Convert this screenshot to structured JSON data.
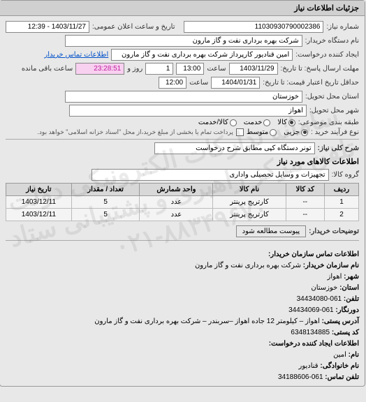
{
  "header": "جزئیات اطلاعات نیاز",
  "need_number_label": "شماره نیاز:",
  "need_number": "11030930790002386",
  "announce_label": "تاریخ و ساعت اعلان عمومی:",
  "announce_value": "1403/11/27 - 12:39",
  "buyer_org_label": "نام دستگاه خریدار:",
  "buyer_org": "شرکت بهره برداری نفت و گاز مارون",
  "requester_label": "ایجاد کننده درخواست:",
  "requester": "امین قنادیور کارپرداز شرکت بهره برداری نفت و گاز مارون",
  "contact_link": "اطلاعات تماس خریدار",
  "deadline_send_label": "مهلت ارسال پاسخ: تا تاریخ:",
  "deadline_send_date": "1403/11/29",
  "time_label": "ساعت",
  "deadline_send_time": "13:00",
  "days_remain": "1",
  "days_label": "روز و",
  "remaining_time": "23:28:51",
  "remaining_label": "ساعت باقی مانده",
  "validity_label": "حداقل تاریخ اعتبار قیمت: تا تاریخ:",
  "validity_date": "1404/01/31",
  "validity_time": "12:00",
  "province_label": "استان محل تحویل:",
  "province": "خوزستان",
  "city_label": "شهر محل تحویل:",
  "city": "اهواز",
  "subject_class_label": "طبقه بندی موضوعی:",
  "radio_goods": "کالا",
  "radio_service": "خدمت",
  "radio_goods_service": "کالا/خدمت",
  "purchase_type_label": "نوع فرآیند خرید :",
  "radio_minor": "جزیی",
  "radio_medium": "متوسط",
  "purchase_note": "پرداخت تمام یا بخشی از مبلغ خرید،از محل \"اسناد خزانه اسلامی\" خواهد بود.",
  "need_desc_label": "شرح کلی نیاز:",
  "need_desc": "تونر دستگاه کپی مطابق شرح درخواست",
  "items_title": "اطلاعات کالاهای مورد نیاز",
  "group_label": "گروه کالا:",
  "group_value": "تجهیزات و وسایل تحصیلی واداری",
  "table": {
    "headers": [
      "ردیف",
      "کد کالا",
      "نام کالا",
      "واحد شمارش",
      "تعداد / مقدار",
      "تاریخ نیاز"
    ],
    "rows": [
      [
        "1",
        "--",
        "کارتریج پرینتر",
        "عدد",
        "5",
        "1403/12/11"
      ],
      [
        "2",
        "--",
        "کارتریج پرینتر",
        "عدد",
        "5",
        "1403/12/11"
      ]
    ]
  },
  "buyer_notes_label": "توضیحات خریدار:",
  "attach_btn": "پیوست مطالعه شود",
  "contact_title": "اطلاعات تماس سازمان خریدار:",
  "org_name_label": "نام سازمان خریدار:",
  "org_name": "شرکت بهره برداری نفت و گاز مارون",
  "city2_label": "شهر:",
  "city2": "اهواز",
  "province2_label": "استان:",
  "province2": "خوزستان",
  "phone_label": "تلفن:",
  "phone": "061-34434080",
  "fax_label": "دورنگار:",
  "fax": "061-34434069",
  "postal_addr_label": "آدرس پستی:",
  "postal_addr": "اهواز – کیلومتر 12 جاده اهواز –سربندر – شرکت بهره برداری نفت و گاز مارون",
  "postal_code_label": "کد پستی:",
  "postal_code": "6348134885",
  "creator_title": "اطلاعات ایجاد کننده درخواست:",
  "fname_label": "نام:",
  "fname": "امین",
  "lname_label": "نام خانوادگی:",
  "lname": "قنادیور",
  "creator_phone_label": "تلفن تماس:",
  "creator_phone": "061-34188606",
  "watermark_line1": "سامانه تدارکات الکترونیکی دولت",
  "watermark_line2": "تلفن مرکز راهبری و پشتیبانی ستاد",
  "watermark_line3": "۰۲۱-۸۸۳۴۹۶۷۰"
}
